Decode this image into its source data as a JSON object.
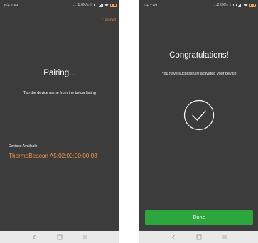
{
  "left_screen": {
    "status": {
      "time": "下午3:49",
      "speed": "....1.0K/s"
    },
    "cancel_label": "Cancel",
    "title": "Pairing...",
    "instruction": "Tap the device name from the below listing",
    "devices_label": "Devices Available",
    "devices": [
      "ThermoBeacon A5:02:00:00:00:03"
    ]
  },
  "right_screen": {
    "status": {
      "time": "下午3:49",
      "speed": "....2.0K/s"
    },
    "title": "Congratulations!",
    "message": "You have successfully activated your device",
    "done_label": "Done"
  },
  "navigation": {
    "back_icon": "back-chevron-icon",
    "home_icon": "home-square-icon",
    "menu_icon": "menu-lines-icon"
  },
  "colors": {
    "background": "#3c3c3c",
    "accent_orange": "#e8873a",
    "device_orange": "#f0954a",
    "done_green": "#2ea63e",
    "nav_bar": "#e9e9e9"
  }
}
